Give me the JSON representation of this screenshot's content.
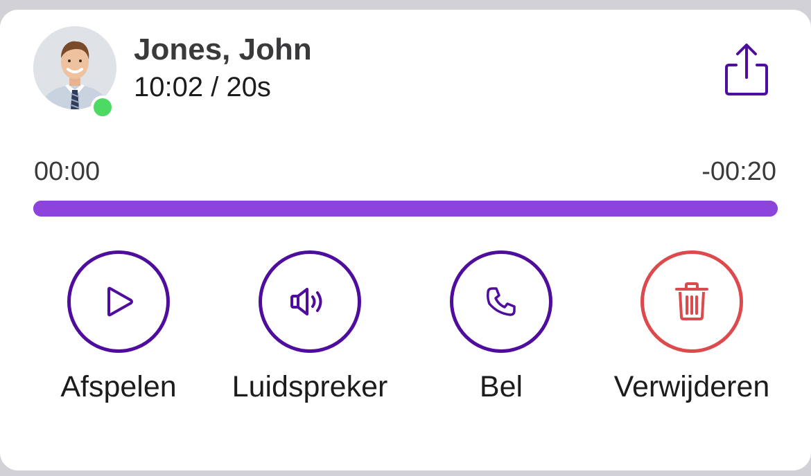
{
  "contact": {
    "name": "Jones, John",
    "meta": "10:02 / 20s",
    "presence": "online",
    "presence_color": "#4cd964"
  },
  "player": {
    "elapsed": "00:00",
    "remaining": "-00:20",
    "progress_fraction": 1.0,
    "bar_color": "#8c44dd"
  },
  "actions": [
    {
      "label": "Afspelen",
      "icon": "play-icon",
      "color": "#4f0d9e"
    },
    {
      "label": "Luidspreker",
      "icon": "speaker-icon",
      "color": "#4f0d9e"
    },
    {
      "label": "Bel",
      "icon": "phone-icon",
      "color": "#4f0d9e"
    },
    {
      "label": "Verwijderen",
      "icon": "trash-icon",
      "color": "#dd4a4d"
    }
  ],
  "share": {
    "icon": "share-icon",
    "color": "#4f0d9e"
  }
}
